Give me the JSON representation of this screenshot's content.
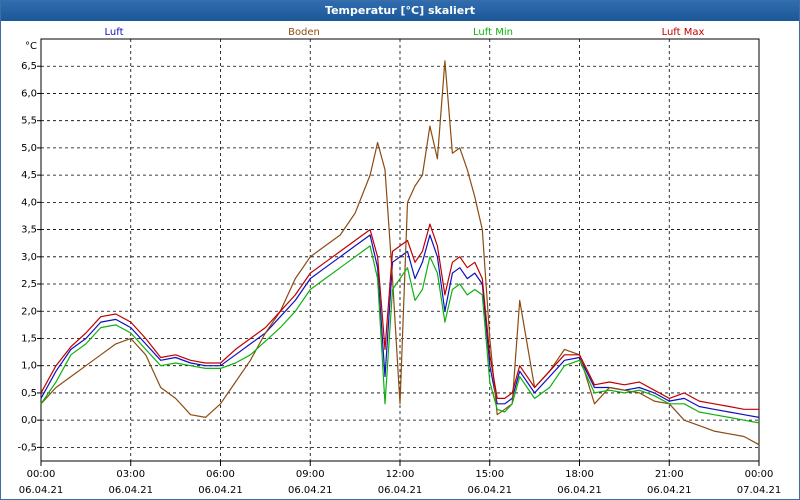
{
  "window": {
    "title": "Temperatur [°C] skaliert"
  },
  "chart_data": {
    "type": "line",
    "title": "Temperatur [°C] skaliert",
    "ylabel": "°C",
    "xlabel": "",
    "ylim": [
      -0.75,
      7.0
    ],
    "y_ticks": [
      -0.5,
      0.0,
      0.5,
      1.0,
      1.5,
      2.0,
      2.5,
      3.0,
      3.5,
      4.0,
      4.5,
      5.0,
      5.5,
      6.0,
      6.5
    ],
    "y_tick_labels": [
      "-0,5",
      "0,0",
      "0,5",
      "1,0",
      "1,5",
      "2,0",
      "2,5",
      "3,0",
      "3,5",
      "4,0",
      "4,5",
      "5,0",
      "5,5",
      "6,0",
      "6,5"
    ],
    "x_ticks": [
      0,
      3,
      6,
      9,
      12,
      15,
      18,
      21,
      24
    ],
    "x_tick_labels": [
      {
        "time": "00:00",
        "date": "06.04.21"
      },
      {
        "time": "03:00",
        "date": "06.04.21"
      },
      {
        "time": "06:00",
        "date": "06.04.21"
      },
      {
        "time": "09:00",
        "date": "06.04.21"
      },
      {
        "time": "12:00",
        "date": "06.04.21"
      },
      {
        "time": "15:00",
        "date": "06.04.21"
      },
      {
        "time": "18:00",
        "date": "06.04.21"
      },
      {
        "time": "21:00",
        "date": "06.04.21"
      },
      {
        "time": "00:00",
        "date": "07.04.21"
      }
    ],
    "grid": true,
    "legend_position": "top",
    "series": [
      {
        "name": "Luft",
        "color": "#1010c0",
        "x": [
          0,
          0.5,
          1,
          1.5,
          2,
          2.5,
          3,
          3.5,
          4,
          4.5,
          5,
          5.5,
          6,
          6.5,
          7,
          7.5,
          8,
          8.5,
          9,
          9.5,
          10,
          10.5,
          11,
          11.25,
          11.5,
          11.75,
          12,
          12.25,
          12.5,
          12.75,
          13,
          13.25,
          13.5,
          13.75,
          14,
          14.25,
          14.5,
          14.75,
          15,
          15.25,
          15.5,
          15.75,
          16,
          16.5,
          17,
          17.5,
          18,
          18.5,
          19,
          19.5,
          20,
          20.5,
          21,
          21.5,
          22,
          22.5,
          23,
          23.5,
          24
        ],
        "values": [
          0.4,
          0.9,
          1.3,
          1.5,
          1.8,
          1.85,
          1.7,
          1.4,
          1.1,
          1.15,
          1.05,
          1.0,
          1.0,
          1.2,
          1.4,
          1.6,
          1.9,
          2.2,
          2.6,
          2.8,
          3.0,
          3.2,
          3.4,
          2.8,
          0.8,
          2.9,
          3.0,
          3.1,
          2.6,
          2.9,
          3.4,
          3.0,
          2.0,
          2.7,
          2.8,
          2.6,
          2.7,
          2.5,
          1.0,
          0.3,
          0.3,
          0.4,
          0.9,
          0.5,
          0.8,
          1.1,
          1.15,
          0.6,
          0.6,
          0.55,
          0.6,
          0.5,
          0.35,
          0.4,
          0.25,
          0.2,
          0.15,
          0.1,
          0.05
        ]
      },
      {
        "name": "Boden",
        "color": "#8b4c12",
        "x": [
          0,
          0.5,
          1,
          1.5,
          2,
          2.5,
          3,
          3.5,
          4,
          4.5,
          5,
          5.5,
          6,
          6.5,
          7,
          7.5,
          8,
          8.5,
          9,
          9.5,
          10,
          10.5,
          11,
          11.25,
          11.5,
          11.75,
          12,
          12.25,
          12.5,
          12.75,
          13,
          13.25,
          13.5,
          13.75,
          14,
          14.25,
          14.5,
          14.75,
          15,
          15.25,
          15.5,
          15.75,
          16,
          16.5,
          17,
          17.5,
          18,
          18.5,
          19,
          19.5,
          20,
          20.5,
          21,
          21.5,
          22,
          22.5,
          23,
          23.5,
          24
        ],
        "values": [
          0.3,
          0.6,
          0.8,
          1.0,
          1.2,
          1.4,
          1.5,
          1.2,
          0.6,
          0.4,
          0.1,
          0.05,
          0.3,
          0.7,
          1.1,
          1.6,
          2.0,
          2.6,
          3.0,
          3.2,
          3.4,
          3.8,
          4.5,
          5.1,
          4.6,
          2.6,
          0.3,
          4.0,
          4.3,
          4.5,
          5.4,
          4.8,
          6.6,
          4.9,
          5.0,
          4.6,
          4.1,
          3.5,
          1.5,
          0.1,
          0.2,
          0.3,
          2.2,
          0.6,
          0.9,
          1.3,
          1.2,
          0.3,
          0.6,
          0.55,
          0.5,
          0.35,
          0.3,
          0.0,
          -0.1,
          -0.2,
          -0.25,
          -0.3,
          -0.45
        ]
      },
      {
        "name": "Luft Min",
        "color": "#10b010",
        "x": [
          0,
          0.5,
          1,
          1.5,
          2,
          2.5,
          3,
          3.5,
          4,
          4.5,
          5,
          5.5,
          6,
          6.5,
          7,
          7.5,
          8,
          8.5,
          9,
          9.5,
          10,
          10.5,
          11,
          11.25,
          11.5,
          11.75,
          12,
          12.25,
          12.5,
          12.75,
          13,
          13.25,
          13.5,
          13.75,
          14,
          14.25,
          14.5,
          14.75,
          15,
          15.25,
          15.5,
          15.75,
          16,
          16.5,
          17,
          17.5,
          18,
          18.5,
          19,
          19.5,
          20,
          20.5,
          21,
          21.5,
          22,
          22.5,
          23,
          23.5,
          24
        ],
        "values": [
          0.3,
          0.7,
          1.2,
          1.4,
          1.7,
          1.75,
          1.6,
          1.3,
          1.0,
          1.05,
          1.0,
          0.95,
          0.95,
          1.05,
          1.2,
          1.45,
          1.7,
          2.0,
          2.4,
          2.6,
          2.8,
          3.0,
          3.2,
          2.6,
          0.3,
          2.4,
          2.6,
          2.8,
          2.2,
          2.4,
          3.0,
          2.7,
          1.8,
          2.4,
          2.5,
          2.3,
          2.4,
          2.3,
          0.7,
          0.2,
          0.15,
          0.3,
          0.8,
          0.4,
          0.6,
          1.0,
          1.1,
          0.5,
          0.55,
          0.5,
          0.55,
          0.45,
          0.3,
          0.3,
          0.15,
          0.1,
          0.05,
          0.0,
          -0.05
        ]
      },
      {
        "name": "Luft Max",
        "color": "#c00000",
        "x": [
          0,
          0.5,
          1,
          1.5,
          2,
          2.5,
          3,
          3.5,
          4,
          4.5,
          5,
          5.5,
          6,
          6.5,
          7,
          7.5,
          8,
          8.5,
          9,
          9.5,
          10,
          10.5,
          11,
          11.25,
          11.5,
          11.75,
          12,
          12.25,
          12.5,
          12.75,
          13,
          13.25,
          13.5,
          13.75,
          14,
          14.25,
          14.5,
          14.75,
          15,
          15.25,
          15.5,
          15.75,
          16,
          16.5,
          17,
          17.5,
          18,
          18.5,
          19,
          19.5,
          20,
          20.5,
          21,
          21.5,
          22,
          22.5,
          23,
          23.5,
          24
        ],
        "values": [
          0.5,
          1.0,
          1.35,
          1.6,
          1.9,
          1.95,
          1.8,
          1.5,
          1.15,
          1.2,
          1.1,
          1.05,
          1.05,
          1.3,
          1.5,
          1.7,
          2.0,
          2.3,
          2.7,
          2.9,
          3.1,
          3.3,
          3.5,
          3.0,
          1.3,
          3.1,
          3.2,
          3.3,
          2.9,
          3.1,
          3.6,
          3.2,
          2.3,
          2.9,
          3.0,
          2.8,
          2.9,
          2.6,
          1.2,
          0.4,
          0.4,
          0.5,
          1.0,
          0.6,
          0.9,
          1.2,
          1.2,
          0.65,
          0.7,
          0.65,
          0.7,
          0.55,
          0.4,
          0.5,
          0.35,
          0.3,
          0.25,
          0.2,
          0.2
        ]
      }
    ]
  }
}
